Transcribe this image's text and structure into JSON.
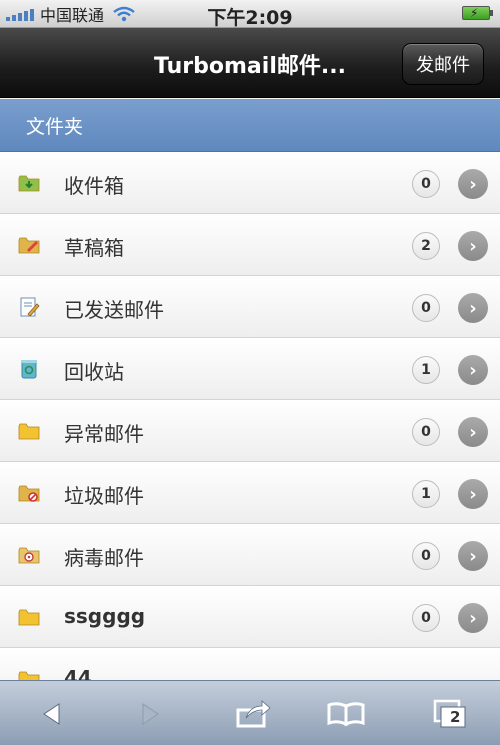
{
  "status": {
    "carrier": "中国联通",
    "time": "下午2:09"
  },
  "navbar": {
    "title": "Turbomail邮件...",
    "compose_label": "发邮件"
  },
  "section": {
    "title": "文件夹"
  },
  "folders": [
    {
      "label": "收件箱",
      "count": "0",
      "icon": "inbox-folder-icon",
      "color": "#8fc14a"
    },
    {
      "label": "草稿箱",
      "count": "2",
      "icon": "drafts-folder-icon",
      "color": "#e0b44a"
    },
    {
      "label": "已发送邮件",
      "count": "0",
      "icon": "sent-mail-icon",
      "color": "#6f8fb5"
    },
    {
      "label": "回收站",
      "count": "1",
      "icon": "recycle-bin-icon",
      "color": "#5fb7c9"
    },
    {
      "label": "异常邮件",
      "count": "0",
      "icon": "folder-icon",
      "color": "#f2c230"
    },
    {
      "label": "垃圾邮件",
      "count": "1",
      "icon": "spam-folder-icon",
      "color": "#e0b44a"
    },
    {
      "label": "病毒邮件",
      "count": "0",
      "icon": "virus-folder-icon",
      "color": "#e8c46a"
    },
    {
      "label": "ssgggg",
      "count": "0",
      "icon": "folder-icon",
      "color": "#f2c230"
    },
    {
      "label": "44",
      "count": "",
      "icon": "folder-icon",
      "color": "#f2c230"
    }
  ],
  "toolbar": {
    "tabs_count": "2",
    "icons": [
      "back-arrow-icon",
      "forward-arrow-icon",
      "share-icon",
      "bookmarks-icon",
      "tabs-icon"
    ]
  }
}
